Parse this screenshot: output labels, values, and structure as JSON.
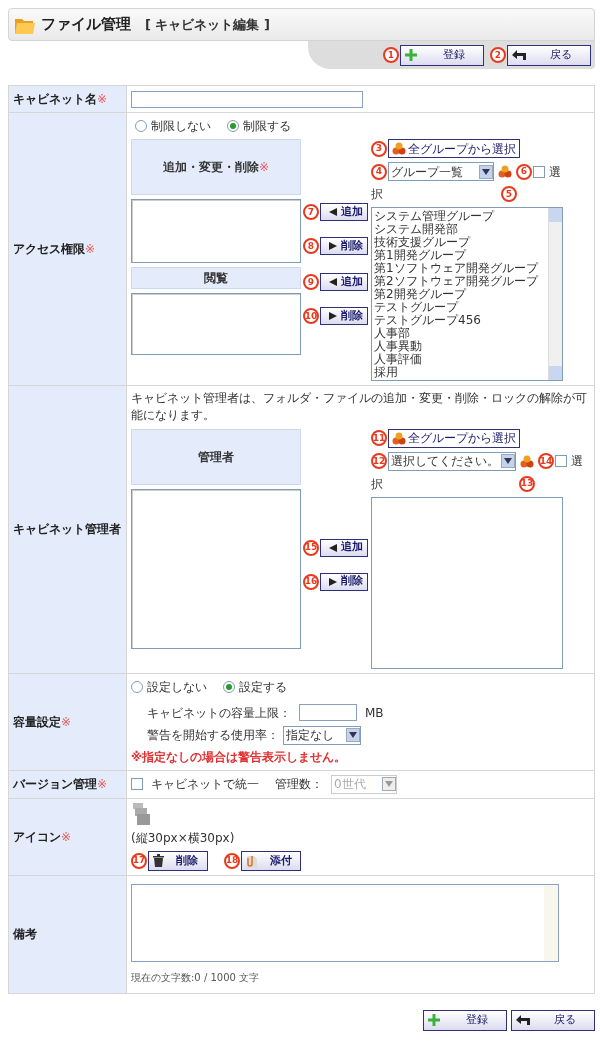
{
  "header": {
    "title": "ファイル管理",
    "subtitle": "[ キャビネット編集 ]"
  },
  "top_buttons": [
    {
      "label": "登録",
      "kind": "register",
      "callout": "1"
    },
    {
      "label": "戻る",
      "kind": "back",
      "callout": "2"
    }
  ],
  "rows": [
    {
      "kind": "name",
      "label": "キャビネット名",
      "mark": "※"
    },
    {
      "kind": "access",
      "label": "アクセス権限",
      "mark": "※",
      "radios": [
        {
          "label": "制限しない",
          "selected": false
        },
        {
          "label": "制限する",
          "selected": true
        }
      ],
      "lists": [
        {
          "heading": "追加・変更・削除",
          "mark": "※",
          "add": {
            "label": "追加",
            "callout": "7"
          },
          "remove": {
            "label": "削除",
            "callout": "8"
          }
        },
        {
          "heading": "閲覧",
          "add": {
            "label": "追加",
            "callout": "9"
          },
          "remove": {
            "label": "削除",
            "callout": "10"
          }
        }
      ],
      "picker": {
        "all_button": {
          "label": "全グループから選択",
          "callout": "3"
        },
        "dropdown": {
          "value": "グループ一覧",
          "callout": "4"
        },
        "checkbox": {
          "label": "選",
          "checked": false,
          "callout": "6"
        },
        "label_tail": "択",
        "list_callout": "5",
        "items": [
          "システム管理グループ",
          "システム開発部",
          "技術支援グループ",
          "第1開発グループ",
          "第1ソフトウェア開発グループ",
          "第2ソフトウェア開発グループ",
          "第2開発グループ",
          "テストグループ",
          "テストグループ456",
          "人事部",
          "人事異動",
          "人事評価",
          "採用"
        ]
      }
    },
    {
      "kind": "admin",
      "label": "キャビネット管理者",
      "note": "キャビネット管理者は、フォルダ・ファイルの追加・変更・削除・ロックの解除が可能になります。",
      "lists": [
        {
          "heading": "管理者",
          "add": {
            "label": "追加",
            "callout": "15"
          },
          "remove": {
            "label": "削除",
            "callout": "16"
          }
        }
      ],
      "picker": {
        "all_button": {
          "label": "全グループから選択",
          "callout": "11"
        },
        "dropdown": {
          "value": "選択してください。",
          "callout": "12"
        },
        "checkbox": {
          "label": "選",
          "checked": false,
          "callout": "14"
        },
        "label_tail": "択",
        "list_callout": "13"
      }
    },
    {
      "kind": "capacity",
      "label": "容量設定",
      "mark": "※",
      "radios": [
        {
          "label": "設定しない",
          "selected": false
        },
        {
          "label": "設定する",
          "selected": true
        }
      ],
      "limit_label": "キャビネットの容量上限：",
      "unit": "MB",
      "warn_label": "警告を開始する使用率：",
      "warn_value": "指定なし",
      "warning": "※指定なしの場合は警告表示しません。"
    },
    {
      "kind": "version",
      "label": "バージョン管理",
      "mark": "※",
      "checkbox": {
        "label": "キャビネットで統一",
        "checked": false
      },
      "count_label": "管理数：",
      "count_value": "0世代",
      "count_disabled": true
    },
    {
      "kind": "icon",
      "label": "アイコン",
      "mark": "※",
      "size_note": "(縦30px×横30px)",
      "buttons": [
        {
          "label": "削除",
          "kind": "delete",
          "callout": "17"
        },
        {
          "label": "添付",
          "kind": "attach",
          "callout": "18"
        }
      ]
    },
    {
      "kind": "notes",
      "label": "備考",
      "counter": "現在の文字数:0 / 1000 文字"
    }
  ],
  "bottom_buttons": [
    {
      "label": "登録",
      "kind": "register"
    },
    {
      "label": "戻る",
      "kind": "back"
    }
  ]
}
